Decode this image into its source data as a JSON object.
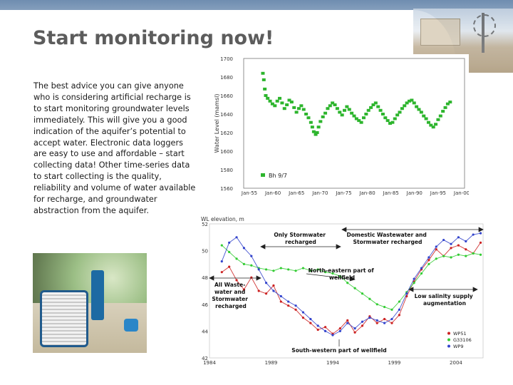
{
  "slide": {
    "title": "Start monitoring now!",
    "body": "The best advice you can give anyone who is considering artificial recharge is to start monitoring groundwater levels immediately. This will give you a good indication of the aquifer’s potential to accept water. Electronic data loggers are easy to use and affordable – start collecting data! Other time-series data to start collecting is the quality, reliability and volume of water available for recharge, and groundwater abstraction from the aquifer."
  },
  "chart_data": [
    {
      "type": "scatter",
      "ylabel": "Water Level (mamsl)",
      "ylim": [
        1560,
        1700
      ],
      "yticks": [
        "1700",
        "1680",
        "1660",
        "1640",
        "1620",
        "1600",
        "1580",
        "1560"
      ],
      "xticks": [
        "Jan-55",
        "Jan-60",
        "Jan-65",
        "Jan-70",
        "Jan-75",
        "Jan-80",
        "Jan-85",
        "Jan-90",
        "Jan-95",
        "Jan-00"
      ],
      "series": [
        {
          "name": "Bh 9/7",
          "color": "#2db52d",
          "points": [
            [
              1959.0,
              1684
            ],
            [
              1959.2,
              1677
            ],
            [
              1959.4,
              1667
            ],
            [
              1959.6,
              1660
            ],
            [
              1960.0,
              1657
            ],
            [
              1960.5,
              1654
            ],
            [
              1961.0,
              1651
            ],
            [
              1961.5,
              1649
            ],
            [
              1962.0,
              1654
            ],
            [
              1962.5,
              1657
            ],
            [
              1963.0,
              1652
            ],
            [
              1963.5,
              1646
            ],
            [
              1964.0,
              1650
            ],
            [
              1964.5,
              1655
            ],
            [
              1965.0,
              1653
            ],
            [
              1965.5,
              1647
            ],
            [
              1966.0,
              1642
            ],
            [
              1966.5,
              1646
            ],
            [
              1967.0,
              1649
            ],
            [
              1967.5,
              1645
            ],
            [
              1968.0,
              1640
            ],
            [
              1968.5,
              1636
            ],
            [
              1969.0,
              1631
            ],
            [
              1969.3,
              1626
            ],
            [
              1969.6,
              1621
            ],
            [
              1970.0,
              1618
            ],
            [
              1970.3,
              1620
            ],
            [
              1970.6,
              1626
            ],
            [
              1971.0,
              1632
            ],
            [
              1971.5,
              1637
            ],
            [
              1972.0,
              1641
            ],
            [
              1972.5,
              1646
            ],
            [
              1973.0,
              1649
            ],
            [
              1973.5,
              1652
            ],
            [
              1974.0,
              1650
            ],
            [
              1974.5,
              1646
            ],
            [
              1975.0,
              1642
            ],
            [
              1975.5,
              1639
            ],
            [
              1976.0,
              1644
            ],
            [
              1976.5,
              1648
            ],
            [
              1977.0,
              1645
            ],
            [
              1977.5,
              1641
            ],
            [
              1978.0,
              1638
            ],
            [
              1978.5,
              1635
            ],
            [
              1979.0,
              1633
            ],
            [
              1979.5,
              1631
            ],
            [
              1980.0,
              1636
            ],
            [
              1980.5,
              1640
            ],
            [
              1981.0,
              1644
            ],
            [
              1981.5,
              1647
            ],
            [
              1982.0,
              1650
            ],
            [
              1982.5,
              1652
            ],
            [
              1983.0,
              1648
            ],
            [
              1983.5,
              1644
            ],
            [
              1984.0,
              1640
            ],
            [
              1984.5,
              1636
            ],
            [
              1985.0,
              1633
            ],
            [
              1985.5,
              1630
            ],
            [
              1986.0,
              1631
            ],
            [
              1986.5,
              1635
            ],
            [
              1987.0,
              1639
            ],
            [
              1987.5,
              1642
            ],
            [
              1988.0,
              1646
            ],
            [
              1988.5,
              1649
            ],
            [
              1989.0,
              1652
            ],
            [
              1989.5,
              1654
            ],
            [
              1990.0,
              1655
            ],
            [
              1990.5,
              1652
            ],
            [
              1991.0,
              1648
            ],
            [
              1991.5,
              1645
            ],
            [
              1992.0,
              1642
            ],
            [
              1992.5,
              1638
            ],
            [
              1993.0,
              1635
            ],
            [
              1993.5,
              1631
            ],
            [
              1994.0,
              1628
            ],
            [
              1994.5,
              1626
            ],
            [
              1995.0,
              1629
            ],
            [
              1995.5,
              1634
            ],
            [
              1996.0,
              1638
            ],
            [
              1996.5,
              1643
            ],
            [
              1997.0,
              1647
            ],
            [
              1997.5,
              1651
            ],
            [
              1998.0,
              1653
            ]
          ]
        }
      ]
    },
    {
      "type": "line",
      "ylabel": "WL elevation, m",
      "ylim": [
        42,
        52
      ],
      "yticks": [
        "52",
        "50",
        "48",
        "46",
        "44",
        "42"
      ],
      "xticks": [
        "1984",
        "1989",
        "1994",
        "1999",
        "2004"
      ],
      "series": [
        {
          "name": "WP51",
          "color": "#cc2222",
          "points": [
            [
              1985.0,
              48.4
            ],
            [
              1985.6,
              48.8
            ],
            [
              1986.2,
              47.8
            ],
            [
              1986.8,
              47.1
            ],
            [
              1987.4,
              48.0
            ],
            [
              1988.0,
              47.0
            ],
            [
              1988.6,
              46.8
            ],
            [
              1989.2,
              47.4
            ],
            [
              1989.8,
              46.2
            ],
            [
              1990.4,
              45.9
            ],
            [
              1991.0,
              45.6
            ],
            [
              1991.6,
              45.0
            ],
            [
              1992.2,
              44.6
            ],
            [
              1992.8,
              44.1
            ],
            [
              1993.4,
              44.3
            ],
            [
              1994.0,
              43.8
            ],
            [
              1994.6,
              44.2
            ],
            [
              1995.2,
              44.8
            ],
            [
              1995.8,
              43.9
            ],
            [
              1996.4,
              44.4
            ],
            [
              1997.0,
              45.1
            ],
            [
              1997.6,
              44.6
            ],
            [
              1998.2,
              44.9
            ],
            [
              1998.8,
              44.6
            ],
            [
              1999.4,
              45.2
            ],
            [
              2000.0,
              46.6
            ],
            [
              2000.6,
              47.7
            ],
            [
              2001.2,
              48.6
            ],
            [
              2001.8,
              49.3
            ],
            [
              2002.4,
              50.1
            ],
            [
              2003.0,
              49.6
            ],
            [
              2003.6,
              50.2
            ],
            [
              2004.2,
              50.4
            ],
            [
              2004.8,
              50.1
            ],
            [
              2005.4,
              49.8
            ],
            [
              2006.0,
              50.6
            ]
          ]
        },
        {
          "name": "G33106",
          "color": "#33cc33",
          "points": [
            [
              1985.0,
              50.4
            ],
            [
              1985.6,
              49.9
            ],
            [
              1986.2,
              49.4
            ],
            [
              1986.8,
              49.0
            ],
            [
              1987.4,
              48.9
            ],
            [
              1988.0,
              48.7
            ],
            [
              1988.6,
              48.6
            ],
            [
              1989.2,
              48.5
            ],
            [
              1989.8,
              48.7
            ],
            [
              1990.4,
              48.6
            ],
            [
              1991.0,
              48.5
            ],
            [
              1991.6,
              48.7
            ],
            [
              1992.2,
              48.5
            ],
            [
              1992.8,
              48.6
            ],
            [
              1993.4,
              48.4
            ],
            [
              1994.0,
              48.3
            ],
            [
              1994.6,
              48.1
            ],
            [
              1995.2,
              47.6
            ],
            [
              1995.8,
              47.2
            ],
            [
              1996.4,
              46.8
            ],
            [
              1997.0,
              46.4
            ],
            [
              1997.6,
              46.0
            ],
            [
              1998.2,
              45.8
            ],
            [
              1998.8,
              45.6
            ],
            [
              1999.4,
              46.2
            ],
            [
              2000.0,
              46.9
            ],
            [
              2000.6,
              47.6
            ],
            [
              2001.2,
              48.3
            ],
            [
              2001.8,
              49.0
            ],
            [
              2002.4,
              49.4
            ],
            [
              2003.0,
              49.6
            ],
            [
              2003.6,
              49.5
            ],
            [
              2004.2,
              49.7
            ],
            [
              2004.8,
              49.6
            ],
            [
              2005.4,
              49.8
            ],
            [
              2006.0,
              49.7
            ]
          ]
        },
        {
          "name": "WP9",
          "color": "#3344cc",
          "points": [
            [
              1985.0,
              49.2
            ],
            [
              1985.6,
              50.6
            ],
            [
              1986.2,
              51.0
            ],
            [
              1986.8,
              50.2
            ],
            [
              1987.4,
              49.6
            ],
            [
              1988.0,
              48.6
            ],
            [
              1988.6,
              47.6
            ],
            [
              1989.2,
              47.0
            ],
            [
              1989.8,
              46.6
            ],
            [
              1990.4,
              46.2
            ],
            [
              1991.0,
              45.9
            ],
            [
              1991.6,
              45.4
            ],
            [
              1992.2,
              44.9
            ],
            [
              1992.8,
              44.4
            ],
            [
              1993.4,
              44.0
            ],
            [
              1994.0,
              43.7
            ],
            [
              1994.6,
              44.0
            ],
            [
              1995.2,
              44.6
            ],
            [
              1995.8,
              44.2
            ],
            [
              1996.4,
              44.7
            ],
            [
              1997.0,
              45.0
            ],
            [
              1997.6,
              44.8
            ],
            [
              1998.2,
              44.6
            ],
            [
              1998.8,
              44.9
            ],
            [
              1999.4,
              45.6
            ],
            [
              2000.0,
              46.8
            ],
            [
              2000.6,
              47.9
            ],
            [
              2001.2,
              48.7
            ],
            [
              2001.8,
              49.5
            ],
            [
              2002.4,
              50.3
            ],
            [
              2003.0,
              50.8
            ],
            [
              2003.6,
              50.5
            ],
            [
              2004.2,
              51.0
            ],
            [
              2004.8,
              50.7
            ],
            [
              2005.4,
              51.2
            ],
            [
              2006.0,
              51.3
            ]
          ]
        }
      ],
      "annotations": [
        "Only Stormwater recharged",
        "Domestic Wastewater and Stormwater recharged",
        "North-eastern part of wellfield",
        "All Waste-water and Stormwater recharged",
        "Low salinity supply augmentation",
        "South-western part of wellfield"
      ]
    }
  ]
}
